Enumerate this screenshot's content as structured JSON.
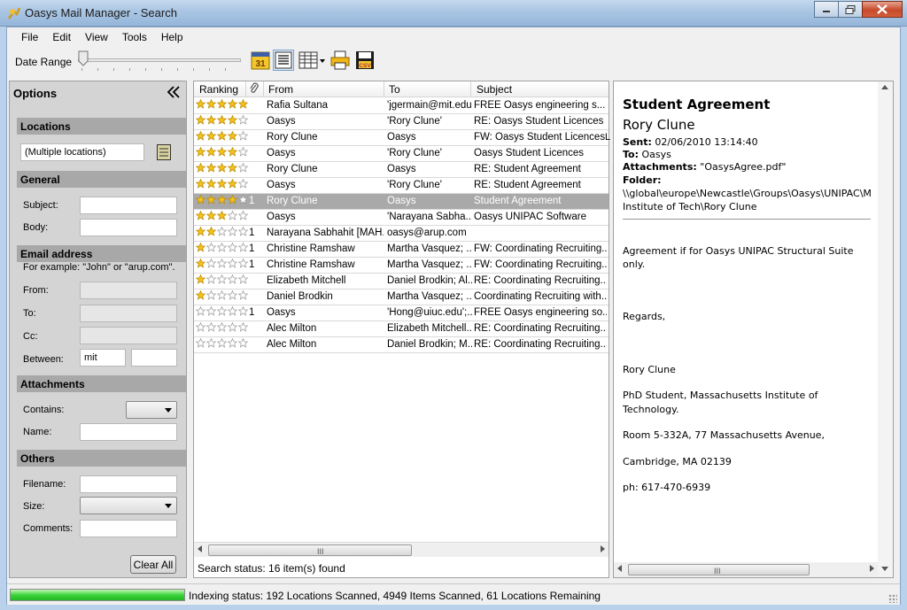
{
  "window": {
    "title": "Oasys Mail Manager - Search"
  },
  "menu": [
    "File",
    "Edit",
    "View",
    "Tools",
    "Help"
  ],
  "toolbar": {
    "date_range_label": "Date Range",
    "calendar_day": "31",
    "csv_label": "CSV"
  },
  "options": {
    "title": "Options",
    "locations": {
      "heading": "Locations",
      "value": "(Multiple locations)"
    },
    "general": {
      "heading": "General",
      "subject_label": "Subject:",
      "body_label": "Body:"
    },
    "email": {
      "heading": "Email address",
      "hint": "For example: \"John\" or \"arup.com\".",
      "from_label": "From:",
      "to_label": "To:",
      "cc_label": "Cc:",
      "between_label": "Between:",
      "between_value": "mit"
    },
    "attachments": {
      "heading": "Attachments",
      "contains_label": "Contains:",
      "name_label": "Name:"
    },
    "others": {
      "heading": "Others",
      "filename_label": "Filename:",
      "size_label": "Size:",
      "comments_label": "Comments:"
    },
    "clear_button": "Clear All"
  },
  "messages": {
    "columns": [
      "Ranking",
      "From",
      "To",
      "Subject"
    ],
    "rows": [
      {
        "stars": 5,
        "count": "",
        "from": "Rafia Sultana",
        "to": "'jgermain@mit.edu'",
        "subject": "FREE Oasys engineering s..."
      },
      {
        "stars": 4,
        "count": "",
        "from": "Oasys",
        "to": "'Rory Clune'",
        "subject": "RE: Oasys Student Licences"
      },
      {
        "stars": 4,
        "count": "",
        "from": "Rory Clune",
        "to": "Oasys",
        "subject": "FW: Oasys Student Licences"
      },
      {
        "stars": 4,
        "count": "",
        "from": "Oasys",
        "to": "'Rory Clune'",
        "subject": "Oasys Student Licences"
      },
      {
        "stars": 4,
        "count": "",
        "from": "Rory Clune",
        "to": "Oasys",
        "subject": "RE: Student Agreement"
      },
      {
        "stars": 4,
        "count": "",
        "from": "Oasys",
        "to": "'Rory Clune'",
        "subject": "RE: Student Agreement"
      },
      {
        "stars": 4,
        "count": "1",
        "from": "Rory Clune",
        "to": "Oasys",
        "subject": "Student Agreement",
        "selected": true
      },
      {
        "stars": 3,
        "count": "",
        "from": "Oasys",
        "to": "'Narayana Sabha...",
        "subject": "Oasys  UNIPAC Software"
      },
      {
        "stars": 2,
        "count": "1",
        "from": "Narayana Sabhahit [MAH...",
        "to": "oasys@arup.com",
        "subject": ""
      },
      {
        "stars": 1,
        "count": "1",
        "from": "Christine Ramshaw",
        "to": "Martha Vasquez; ...",
        "subject": "FW: Coordinating Recruiting..."
      },
      {
        "stars": 1,
        "count": "1",
        "from": "Christine Ramshaw",
        "to": "Martha Vasquez; ...",
        "subject": "FW: Coordinating Recruiting..."
      },
      {
        "stars": 1,
        "count": "",
        "from": "Elizabeth Mitchell",
        "to": "Daniel Brodkin; Al...",
        "subject": "RE: Coordinating Recruiting..."
      },
      {
        "stars": 1,
        "count": "",
        "from": "Daniel Brodkin",
        "to": "Martha Vasquez; ...",
        "subject": "Coordinating Recruiting with..."
      },
      {
        "stars": 0,
        "count": "1",
        "from": "Oasys",
        "to": "'Hong@uiuc.edu';...",
        "subject": "FREE Oasys engineering so..."
      },
      {
        "stars": 0,
        "count": "",
        "from": "Alec Milton",
        "to": "Elizabeth Mitchell...",
        "subject": "RE: Coordinating Recruiting..."
      },
      {
        "stars": 0,
        "count": "",
        "from": "Alec Milton",
        "to": "Daniel Brodkin; M...",
        "subject": "RE: Coordinating Recruiting..."
      }
    ],
    "overflow_char": "L",
    "scroll_grip": "III",
    "search_status": "Search status: 16 item(s) found"
  },
  "preview": {
    "title": "Student Agreement",
    "sender": "Rory Clune",
    "sent_label": "Sent:",
    "sent_value": "02/06/2010 13:14:40",
    "to_label": "To:",
    "to_value": "Oasys",
    "attachments_label": "Attachments:",
    "attachments_value": "\"OasysAgree.pdf\"",
    "folder_label": "Folder:",
    "folder_line1": "\\\\global\\europe\\Newcastle\\Groups\\Oasys\\UNIPAC\\M",
    "folder_line2": "Institute of Tech\\Rory Clune",
    "body": [
      "Agreement if for Oasys UNIPAC Structural Suite",
      "only.",
      "Regards,",
      "Rory Clune",
      "PhD Student, Massachusetts Institute of",
      "Technology.",
      "Room 5-332A, 77 Massachusetts Avenue,",
      "Cambridge, MA 02139",
      "ph: 617-470-6939"
    ],
    "scroll_grip": "III"
  },
  "status": {
    "indexing_progress": 1.0,
    "indexing": "Indexing status: 192 Locations Scanned, 4949 Items Scanned, 61 Locations Remaining"
  },
  "colors": {
    "accent": "#3dd43d",
    "selected_row": "#a9a9a9",
    "section": "#a8a8a8"
  }
}
